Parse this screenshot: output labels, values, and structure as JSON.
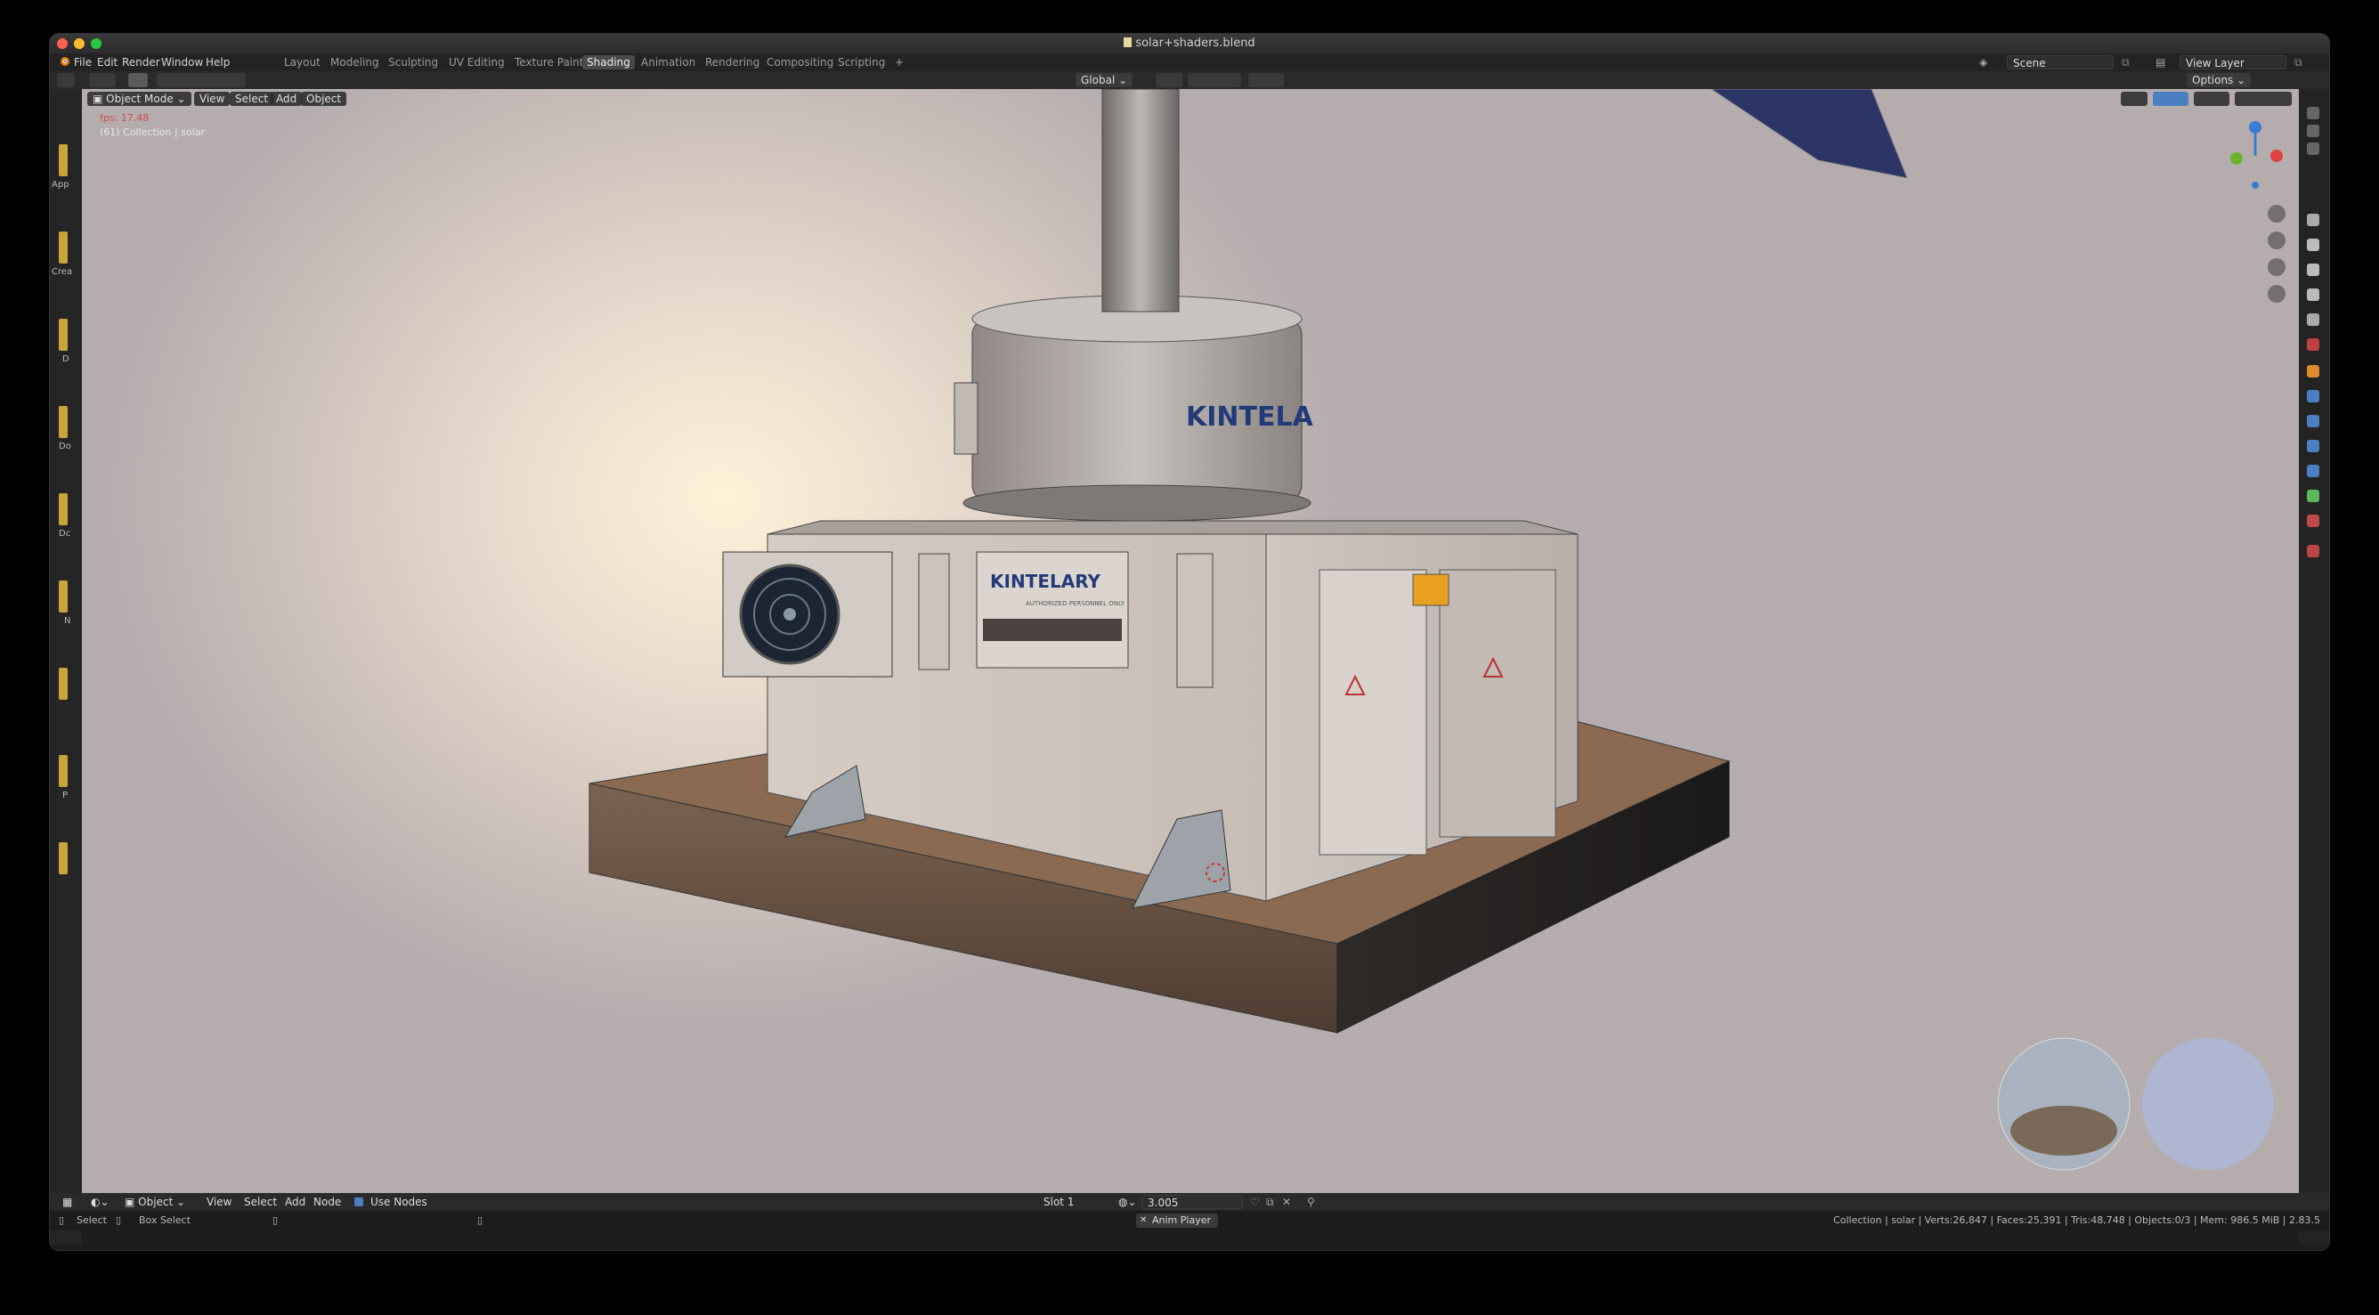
{
  "window": {
    "title": "solar+shaders.blend"
  },
  "menu": [
    "File",
    "Edit",
    "Render",
    "Window",
    "Help"
  ],
  "workspaces": [
    "Layout",
    "Modeling",
    "Sculpting",
    "UV Editing",
    "Texture Paint",
    "Shading",
    "Animation",
    "Rendering",
    "Compositing",
    "Scripting"
  ],
  "active_workspace": "Shading",
  "scene": {
    "name": "Scene",
    "view_layer": "View Layer"
  },
  "header": {
    "transform_orientation": "Global",
    "options": "Options"
  },
  "viewport": {
    "mode": "Object Mode",
    "menus": [
      "View",
      "Select",
      "Add",
      "Object"
    ],
    "fps": "fps: 17.48",
    "collection": "(61) Collection | solar",
    "sign_text": "KINTELARY",
    "sign_sub": "AUTHORIZED PERSONNEL ONLY",
    "tank_text": "KINTELA"
  },
  "left_panel": {
    "labels": [
      "App",
      "Crea",
      "D",
      "Do",
      "Dc",
      "N",
      "P"
    ]
  },
  "node_editor": {
    "type": "Object",
    "menus": [
      "View",
      "Select",
      "Add",
      "Node"
    ],
    "use_nodes": "Use Nodes",
    "slot": "Slot 1",
    "material": "3.005"
  },
  "statusbar": {
    "select": "Select",
    "box_select": "Box Select",
    "center": "Anim Player",
    "stats": "Collection | solar | Verts:26,847 | Faces:25,391 | Tris:48,748 | Objects:0/3 | Mem: 986.5 MiB | 2.83.5"
  },
  "colors": {
    "accent": "#4a7fc1",
    "active_tab": "#4a4a4a",
    "warning_orange": "#e8a020"
  }
}
